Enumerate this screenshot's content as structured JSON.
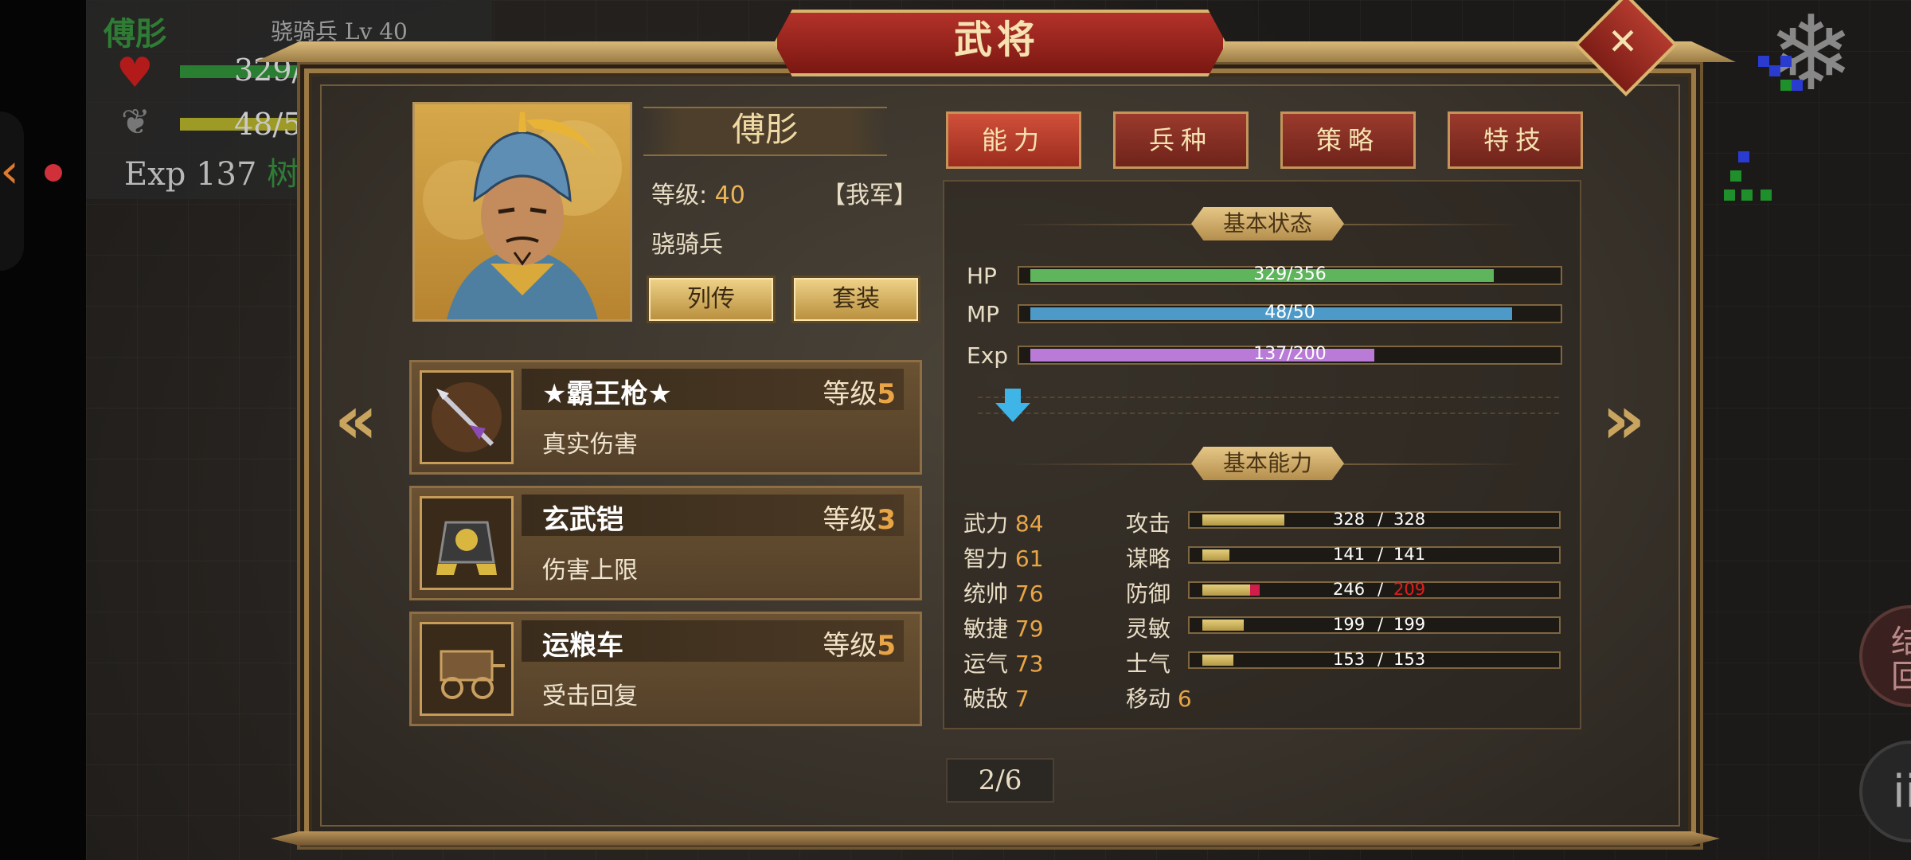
{
  "hud": {
    "name": "傅肜",
    "unit": "骁骑兵 Lv 40",
    "hp": "329/",
    "mp": "48/5",
    "exp_label": "Exp 137",
    "exp_trail": "树"
  },
  "dialog": {
    "title": "武将",
    "close_icon": "close-x-icon"
  },
  "general": {
    "name": "傅肜",
    "level_label": "等级:",
    "level_value": "40",
    "army": "【我军】",
    "troop_type": "骁骑兵",
    "buttons": [
      "列传",
      "套装"
    ]
  },
  "tabs": [
    {
      "label": "能力",
      "active": true
    },
    {
      "label": "兵种",
      "active": false
    },
    {
      "label": "策略",
      "active": false
    },
    {
      "label": "特技",
      "active": false
    }
  ],
  "equipment": [
    {
      "name": "★霸王枪★",
      "level_label": "等级",
      "level": "5",
      "desc": "真实伤害",
      "icon": "spear-icon"
    },
    {
      "name": "玄武铠",
      "level_label": "等级",
      "level": "3",
      "desc": "伤害上限",
      "icon": "armor-icon"
    },
    {
      "name": "运粮车",
      "level_label": "等级",
      "level": "5",
      "desc": "受击回复",
      "icon": "supply-cart-icon"
    }
  ],
  "basic_status": {
    "title": "基本状态",
    "bars": [
      {
        "label": "HP",
        "text": "329/356",
        "fraction": 0.924,
        "color": "#5fb55c"
      },
      {
        "label": "MP",
        "text": "48/50",
        "fraction": 0.96,
        "color": "#4d9ac9"
      },
      {
        "label": "Exp",
        "text": "137/200",
        "fraction": 0.685,
        "color": "#b97ad8"
      }
    ]
  },
  "basic_ability": {
    "title": "基本能力",
    "attributes": [
      {
        "label": "武力",
        "value": "84"
      },
      {
        "label": "智力",
        "value": "61"
      },
      {
        "label": "统帅",
        "value": "76"
      },
      {
        "label": "敏捷",
        "value": "79"
      },
      {
        "label": "运气",
        "value": "73"
      },
      {
        "label": "破敌",
        "value": "7"
      }
    ],
    "combat": [
      {
        "label": "攻击",
        "current": "328",
        "max": "328",
        "fraction": 0.24
      },
      {
        "label": "谋略",
        "current": "141",
        "max": "141",
        "fraction": 0.08
      },
      {
        "label": "防御",
        "current": "246",
        "max": "209",
        "fraction": 0.14,
        "max_color": "#e11c1c"
      },
      {
        "label": "灵敏",
        "current": "199",
        "max": "199",
        "fraction": 0.12
      },
      {
        "label": "士气",
        "current": "153",
        "max": "153",
        "fraction": 0.09
      }
    ],
    "move_label": "移动",
    "move_value": "6"
  },
  "pager": "2/6",
  "side_buttons": {
    "right_top": "结\n回",
    "right_bottom": "ii"
  }
}
